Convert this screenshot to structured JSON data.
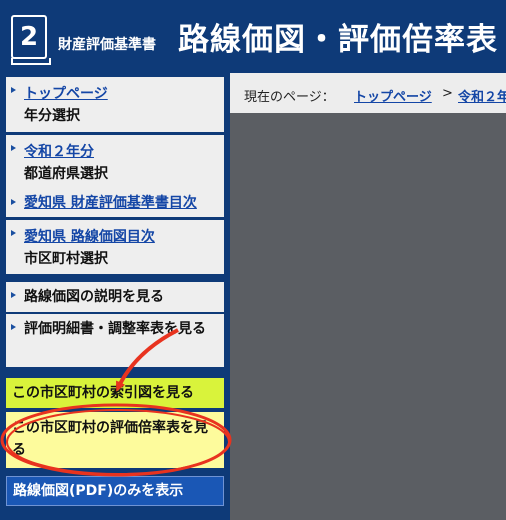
{
  "header": {
    "logo_number": "2",
    "subtitle": "財産評価基準書",
    "title": "路線価図・評価倍率表"
  },
  "sidebar": {
    "items": [
      {
        "link": "トップページ",
        "sub": "年分選択"
      },
      {
        "link": "令和２年分",
        "sub": "都道府県選択"
      },
      {
        "link": "愛知県 財産評価基準書目次"
      },
      {
        "link": "愛知県 路線価図目次",
        "sub": "市区町村選択"
      },
      {
        "label": "路線価図の説明を見る"
      },
      {
        "label": "評価明細書・調整率表を見る"
      }
    ],
    "index_map_button": "この市区町村の索引図を見る",
    "ratio_table_button": "この市区町村の評価倍率表を見る",
    "pdf_only_button": "路線価図(PDF)のみを表示"
  },
  "breadcrumb": {
    "label": "現在のページ：",
    "items": [
      "トップページ",
      "令和２年"
    ],
    "separator": ">"
  },
  "colors": {
    "header_bg": "#0e3a78",
    "highlight_green": "#d9f33b",
    "highlight_yellow": "#fdfb9c",
    "pdf_button": "#1a57b5",
    "annotation_red": "#e8331f"
  }
}
